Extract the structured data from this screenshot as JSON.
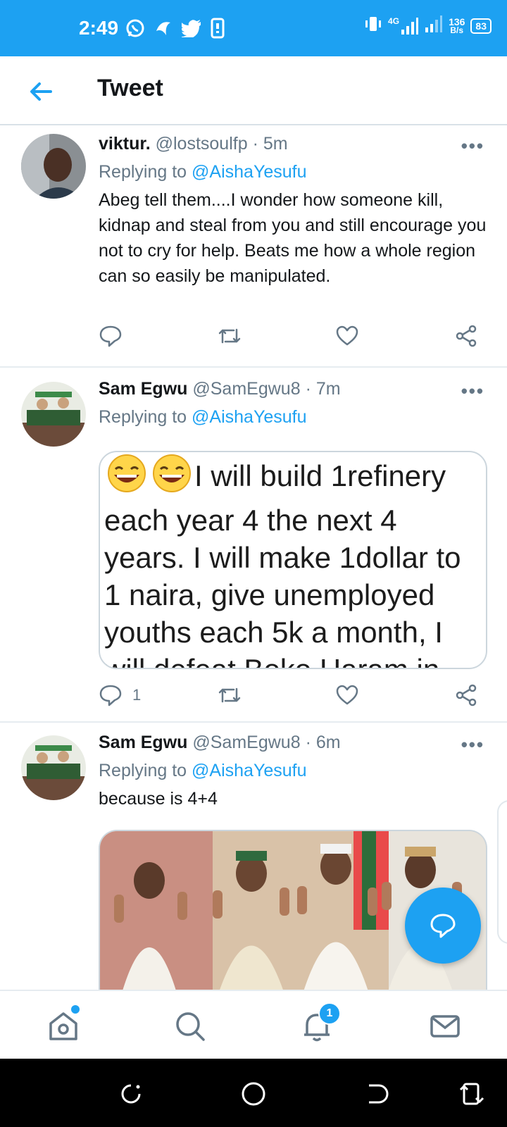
{
  "status_bar": {
    "time": "2:49",
    "network": "4G",
    "speed_value": "136",
    "speed_unit": "B/s",
    "battery": "83",
    "accent_color": "#1da1f2"
  },
  "header": {
    "title": "Tweet",
    "back_icon": "arrow-left-icon"
  },
  "tweets": [
    {
      "name": "viktur.",
      "handle": "@lostsoulfp",
      "sep": "·",
      "time": "5m",
      "replying_prefix": "Replying to",
      "replying_to": "@AishaYesufu",
      "text": "Abeg tell them....I wonder how someone kill, kidnap and steal from you and still encourage you not to cry for help.  Beats me how a whole region can so easily be manipulated.",
      "reply_count": ""
    },
    {
      "name": "Sam Egwu",
      "handle": "@SamEgwu8",
      "sep": "·",
      "time": "7m",
      "replying_prefix": "Replying to",
      "replying_to": "@AishaYesufu",
      "image_text": "I will build 1refinery each year 4 the next 4 years. I will make 1dollar to 1 naira, give unemployed youths each 5k a month, I will defeat Boko Haram in",
      "reply_count": "1"
    },
    {
      "name": "Sam Egwu",
      "handle": "@SamEgwu8",
      "sep": "·",
      "time": "6m",
      "replying_prefix": "Replying to",
      "replying_to": "@AishaYesufu",
      "text": "because is 4+4"
    }
  ],
  "more_label": "•••",
  "bottom_nav": {
    "notification_count": "1"
  }
}
